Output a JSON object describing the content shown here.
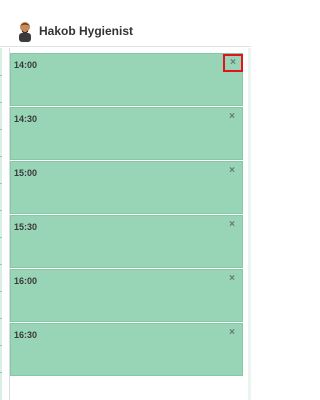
{
  "header": {
    "name": "Hakob Hygienist",
    "avatar_icon": "person-avatar-icon"
  },
  "slots": [
    {
      "time": "14:00",
      "close_glyph": "×",
      "highlighted": true
    },
    {
      "time": "14:30",
      "close_glyph": "×",
      "highlighted": false
    },
    {
      "time": "15:00",
      "close_glyph": "×",
      "highlighted": false
    },
    {
      "time": "15:30",
      "close_glyph": "×",
      "highlighted": false
    },
    {
      "time": "16:00",
      "close_glyph": "×",
      "highlighted": false
    },
    {
      "time": "16:30",
      "close_glyph": "×",
      "highlighted": false
    }
  ],
  "colors": {
    "slot_fill": "#98d4b6",
    "highlight_border": "#e3121b"
  }
}
